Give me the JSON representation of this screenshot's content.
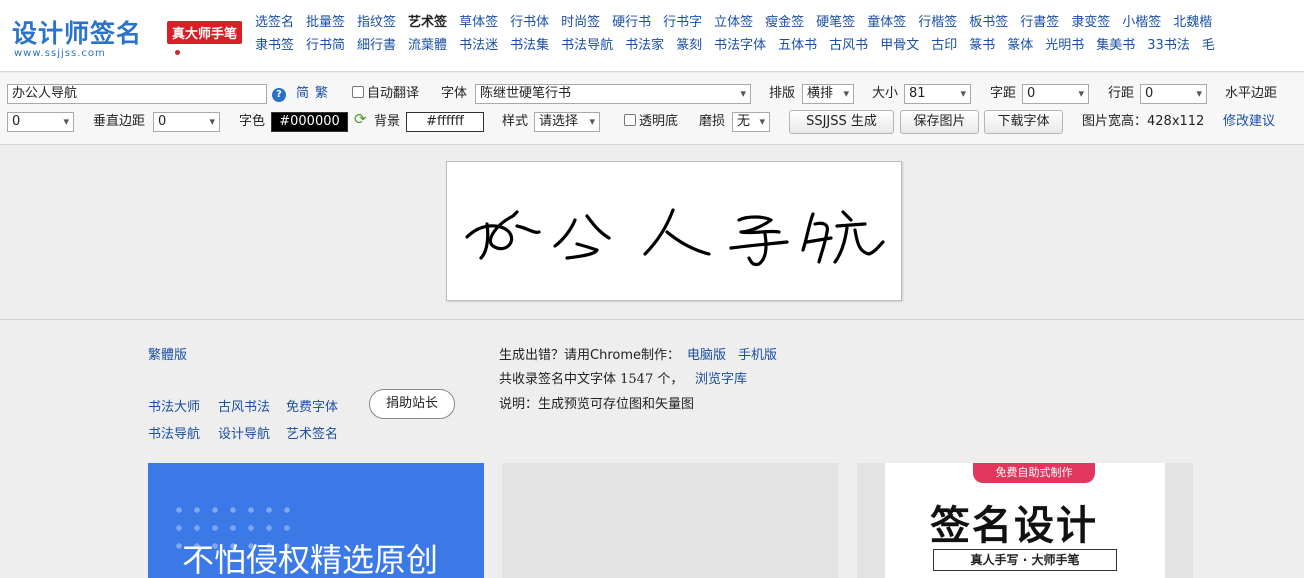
{
  "header": {
    "logo_text": "设计师签名",
    "logo_badge": "真大师手笔",
    "logo_url": "www.ssjjss.com",
    "nav_row1": [
      "选签名",
      "批量签",
      "指纹签",
      "艺术签",
      "草体签",
      "行书体",
      "时尚签",
      "硬行书",
      "行书字",
      "立体签",
      "瘦金签",
      "硬笔签",
      "童体签",
      "行楷签",
      "板书签",
      "行書签",
      "隶变签",
      "小楷签",
      "北魏楷"
    ],
    "nav_row2": [
      "隶书签",
      "行书简",
      "細行書",
      "流葉體",
      "书法迷",
      "书法集",
      "书法导航",
      "书法家",
      "篆刻",
      "书法字体",
      "五体书",
      "古风书",
      "甲骨文",
      "古印",
      "篆书",
      "篆体",
      "光明书",
      "集美书",
      "33书法",
      "毛"
    ]
  },
  "toolbar": {
    "text_value": "办公人导航",
    "simplified": "简",
    "traditional": "繁",
    "auto_translate": "自动翻译",
    "font_label": "字体",
    "font_value": "陈继世硬笔行书",
    "layout_label": "排版",
    "layout_value": "横排",
    "size_label": "大小",
    "size_value": "81",
    "spacing_label": "字距",
    "spacing_value": "0",
    "line_spacing_label": "行距",
    "line_spacing_value": "0",
    "h_margin_label": "水平边距",
    "h_margin_value": "0",
    "v_margin_label": "垂直边距",
    "v_margin_value": "0",
    "color_label": "字色",
    "color_value": "#000000",
    "bg_label": "背景",
    "bg_value": "#ffffff",
    "style_label": "样式",
    "style_value": "请选择",
    "transparent_label": "透明底",
    "wear_label": "磨损",
    "wear_value": "无",
    "generate_button": "SSJJSS 生成",
    "save_button": "保存图片",
    "download_button": "下载字体",
    "image_size": "图片宽高：428x112",
    "feedback_link": "修改建议"
  },
  "preview": {
    "signature_text": "办公人导航"
  },
  "info": {
    "traditional_link": "繁體版",
    "links_row1": [
      "书法大师",
      "古风书法",
      "免费字体"
    ],
    "links_row2": [
      "书法导航",
      "设计导航",
      "艺术签名"
    ],
    "donate_button": "捐助站长",
    "line1_text": "生成出错？请用Chrome制作：",
    "line1_link_pc": "电脑版",
    "line1_link_mobile": "手机版",
    "line2_text_a": "共收录签名中文字体 ",
    "line2_count": "1547",
    "line2_text_b": " 个，",
    "line2_link": "浏览字库",
    "line3_text": "说明：生成预览可存位图和矢量图"
  },
  "cards": {
    "blue_text": "不怕侵权精选原创",
    "poster_ribbon": "免费自助式制作",
    "poster_title": "签名设计",
    "poster_sub": "真人手写 · 大师手笔"
  },
  "colors": {
    "link": "#1a4fa3",
    "logo_blue": "#2a73c8",
    "logo_red": "#d91f26",
    "card_blue": "#3b7ae6",
    "ribbon": "#e2375c"
  }
}
